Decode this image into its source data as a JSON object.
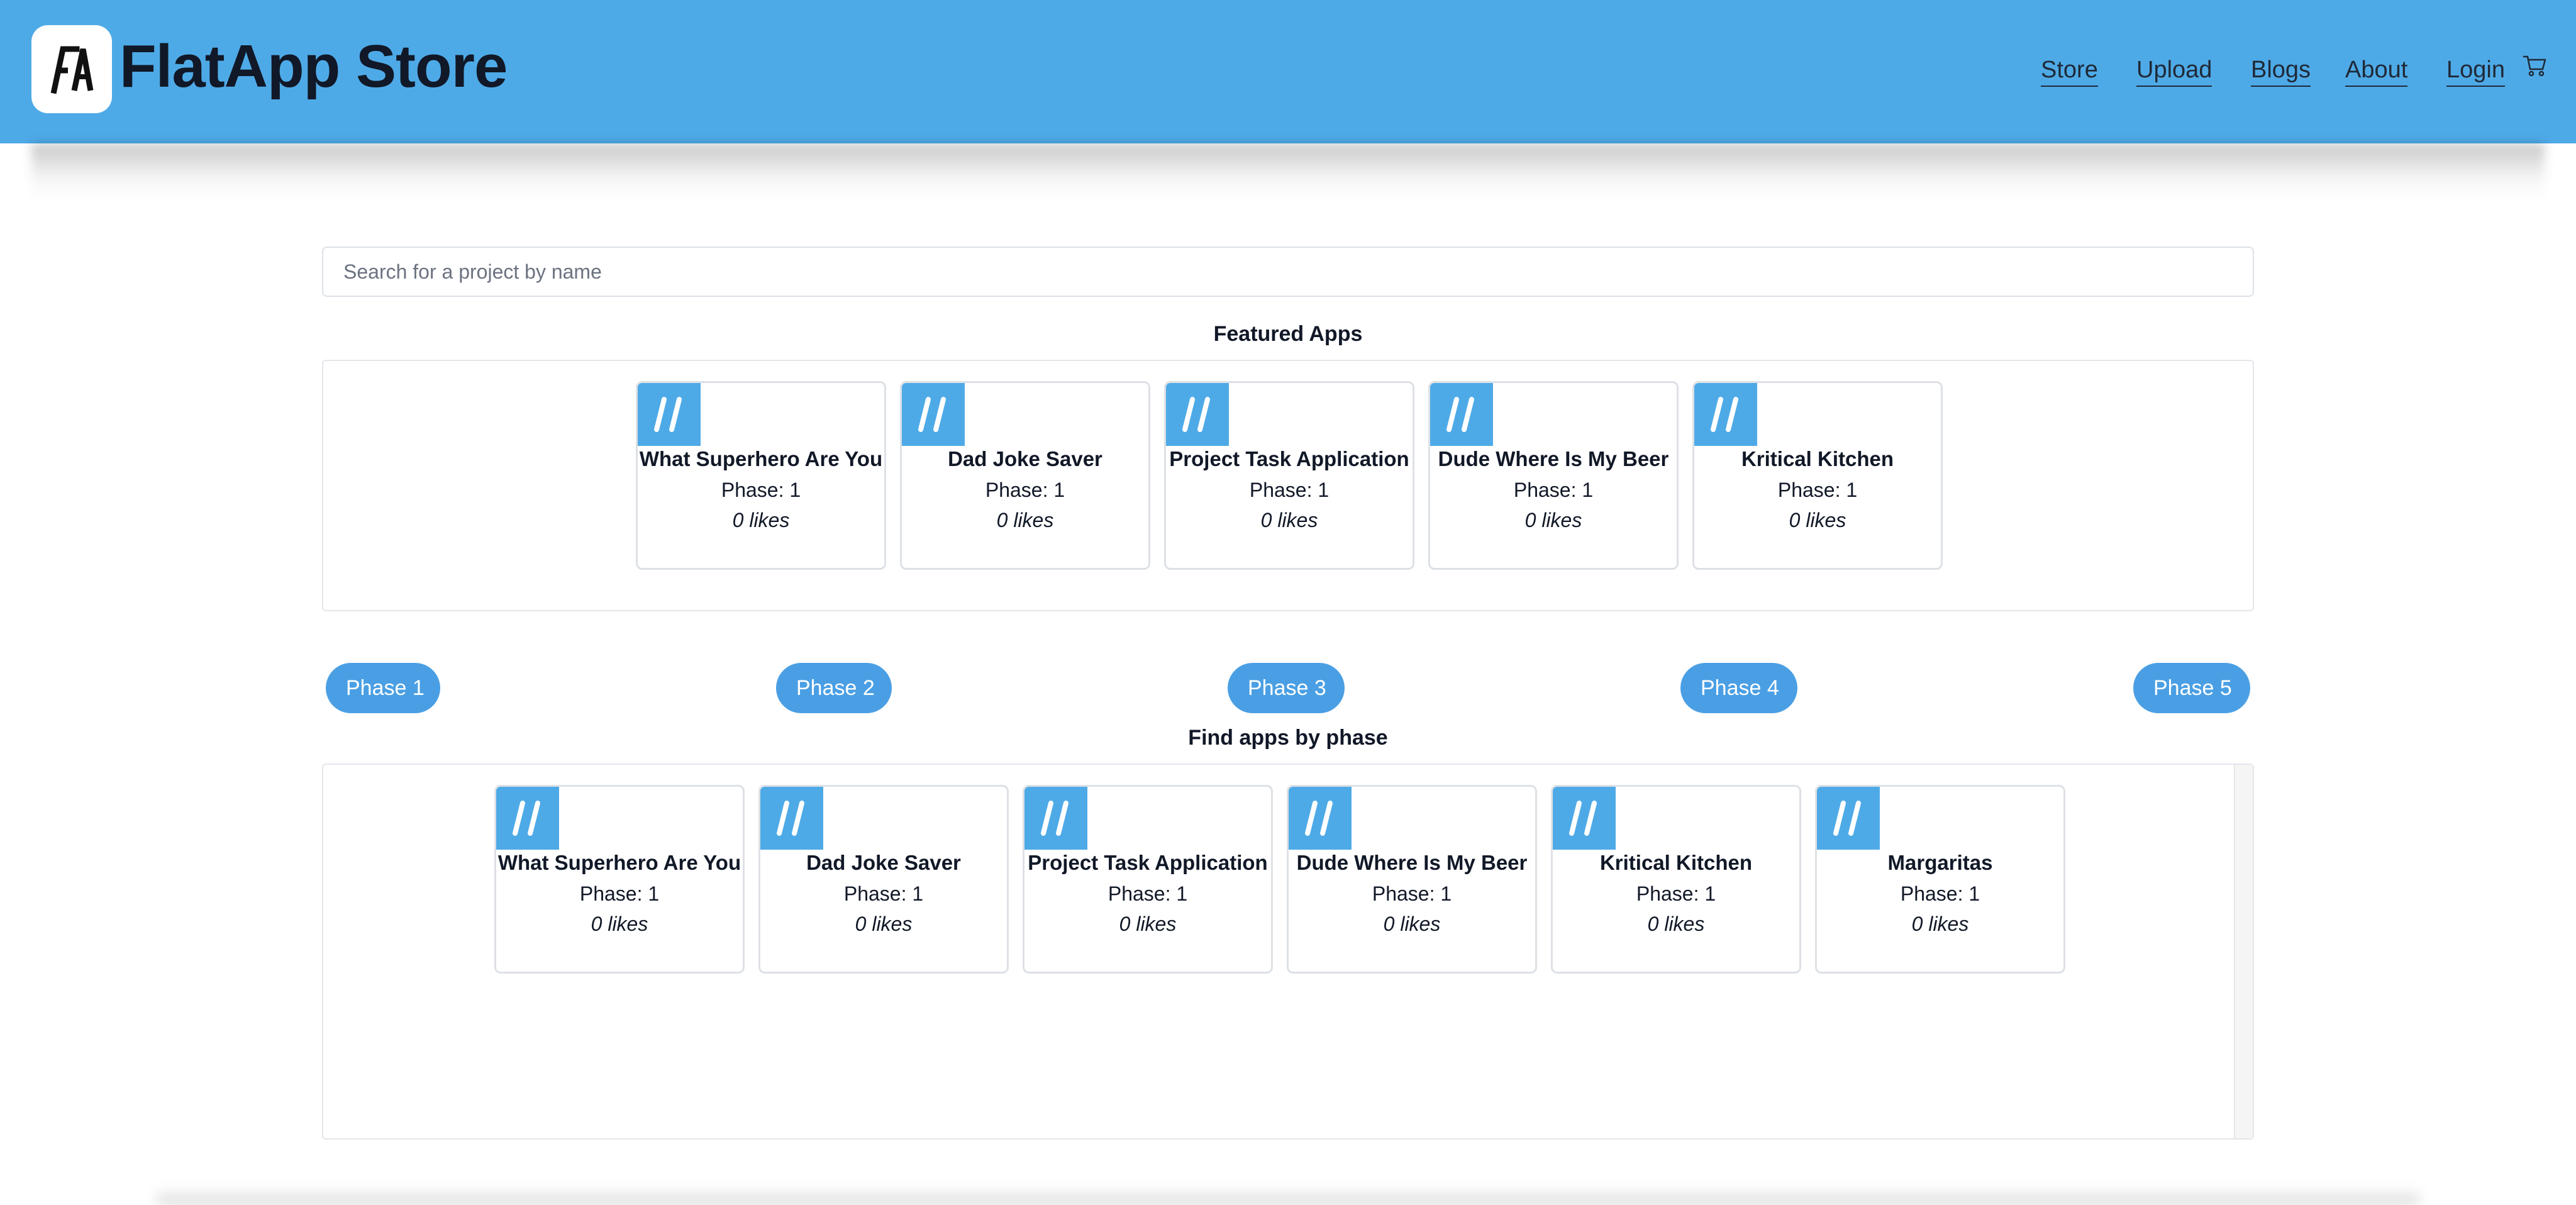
{
  "header": {
    "logo_alt": "FA",
    "title": "FlatApp Store",
    "nav": [
      {
        "label": "Store"
      },
      {
        "label": "Upload"
      },
      {
        "label": "Blogs"
      },
      {
        "label": "About"
      },
      {
        "label": "Login"
      }
    ],
    "cart_icon": "cart-icon",
    "colors": {
      "header_bg": "#4eaae7",
      "button_bg": "#4a9fe4"
    }
  },
  "search": {
    "placeholder": "Search for a project by name",
    "value": ""
  },
  "featured": {
    "title": "Featured Apps",
    "apps": [
      {
        "name": "What Superhero Are You",
        "phase": "Phase: 1",
        "likes": "0 likes"
      },
      {
        "name": "Dad Joke Saver",
        "phase": "Phase: 1",
        "likes": "0 likes"
      },
      {
        "name": "Project Task Application",
        "phase": "Phase: 1",
        "likes": "0 likes"
      },
      {
        "name": "Dude Where Is My Beer",
        "phase": "Phase: 1",
        "likes": "0 likes"
      },
      {
        "name": "Kritical Kitchen",
        "phase": "Phase: 1",
        "likes": "0 likes"
      }
    ]
  },
  "phases": {
    "buttons": [
      {
        "label": "Phase 1"
      },
      {
        "label": "Phase 2"
      },
      {
        "label": "Phase 3"
      },
      {
        "label": "Phase 4"
      },
      {
        "label": "Phase 5"
      }
    ],
    "title": "Find apps by phase",
    "apps": [
      {
        "name": "What Superhero Are You",
        "phase": "Phase: 1",
        "likes": "0 likes"
      },
      {
        "name": "Dad Joke Saver",
        "phase": "Phase: 1",
        "likes": "0 likes"
      },
      {
        "name": "Project Task Application",
        "phase": "Phase: 1",
        "likes": "0 likes"
      },
      {
        "name": "Dude Where Is My Beer",
        "phase": "Phase: 1",
        "likes": "0 likes"
      },
      {
        "name": "Kritical Kitchen",
        "phase": "Phase: 1",
        "likes": "0 likes"
      },
      {
        "name": "Margaritas",
        "phase": "Phase: 1",
        "likes": "0 likes"
      }
    ]
  }
}
